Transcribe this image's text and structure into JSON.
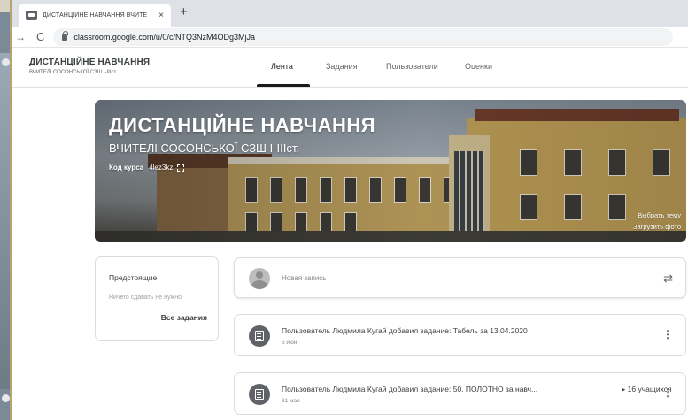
{
  "browser": {
    "tab_title": "ДИСТАНЦІЙНЕ НАВЧАННЯ ВЧИТЕ",
    "tab_close": "×",
    "new_tab": "+",
    "url": "classroom.google.com/u/0/c/NTQ3NzM4ODg3MjJa"
  },
  "classroom": {
    "title": "ДИСТАНЦІЙНЕ НАВЧАННЯ",
    "subtitle": "ВЧИТЕЛІ СОСОНСЬКОЇ СЗШ І-ІІІст.",
    "tabs": [
      {
        "label": "Лента"
      },
      {
        "label": "Задания"
      },
      {
        "label": "Пользователи"
      },
      {
        "label": "Оценки"
      }
    ]
  },
  "banner": {
    "title": "ДИСТАНЦІЙНЕ НАВЧАННЯ",
    "subtitle": "ВЧИТЕЛІ СОСОНСЬКОЇ СЗШ І-ІІІст.",
    "code_label": "Код курса",
    "code_value": "4lez3kz",
    "select_theme": "Выбрать тему",
    "upload_photo": "Загрузить фото"
  },
  "upcoming": {
    "title": "Предстоящие",
    "empty_text": "Ничего сдавать не нужно",
    "all_link": "Все задания"
  },
  "composer": {
    "placeholder": "Новая запись"
  },
  "stream": [
    {
      "title": "Пользователь Людмила Кугай добавил задание: Табель за 13.04.2020",
      "date": "5 июн.",
      "meta": ""
    },
    {
      "title": "Пользователь Людмила Кугай добавил задание: 50. ПОЛОТНО за навч...",
      "date": "31 мая",
      "meta": "▸ 16 учащихся"
    }
  ],
  "icons": {
    "repost": "⇄",
    "more": "⋮",
    "forward": "→",
    "reload": "C"
  }
}
